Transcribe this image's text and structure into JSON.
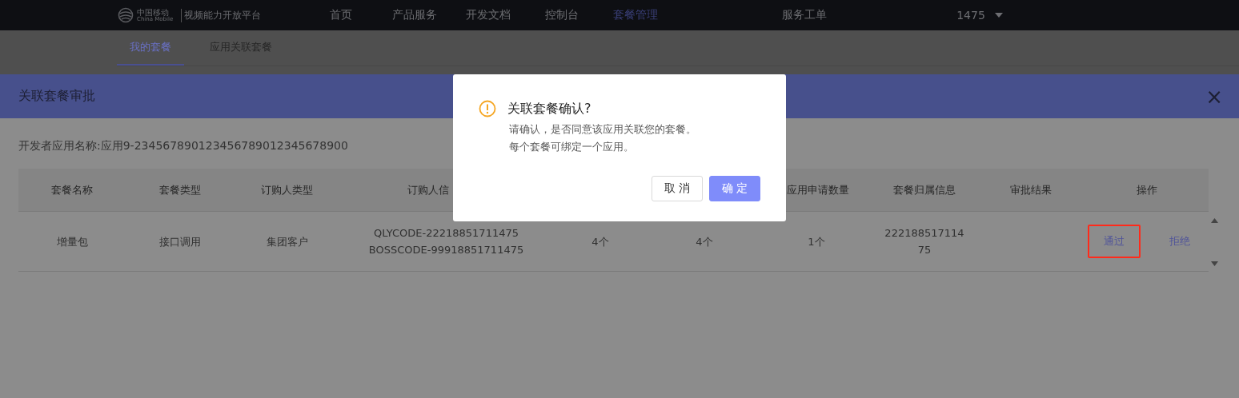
{
  "top_nav": {
    "logo": {
      "name_cn": "中国移动",
      "name_en": "China Mobile"
    },
    "platform": "视频能力开放平台",
    "items": [
      {
        "label": "首页",
        "selected": false
      },
      {
        "label": "产品服务",
        "selected": false
      },
      {
        "label": "开发文档",
        "selected": false
      },
      {
        "label": "控制台",
        "selected": false
      },
      {
        "label": "套餐管理",
        "selected": true
      }
    ],
    "service": "服务工单",
    "user": "1475"
  },
  "sub_tabs": [
    {
      "label": "我的套餐",
      "selected": true
    },
    {
      "label": "应用关联套餐",
      "selected": false
    }
  ],
  "drawer": {
    "title": "关联套餐审批",
    "close": "×",
    "app_name": "开发者应用名称:应用9-234567890123456789012345678900",
    "table": {
      "columns": [
        "套餐名称",
        "套餐类型",
        "订购人类型",
        "订购人信",
        null,
        null,
        "应用申请数量",
        "套餐归属信息",
        "审批结果",
        "操作"
      ],
      "rows": [
        {
          "cells": [
            "增量包",
            "接口调用",
            "集团客户",
            [
              "QLYCODE-22218851711475",
              "BOSSCODE-99918851711475"
            ],
            "4个",
            "4个",
            "1个",
            [
              "222188517114",
              "75"
            ],
            ""
          ],
          "actions": [
            {
              "label": "通过",
              "highlighted": true
            },
            {
              "label": "拒绝",
              "highlighted": false
            }
          ]
        }
      ]
    }
  },
  "dialog": {
    "title": "关联套餐确认?",
    "lines": [
      "请确认，是否同意该应用关联您的套餐。",
      "每个套餐可绑定一个应用。"
    ],
    "buttons": [
      {
        "label": "取 消",
        "kind": "default"
      },
      {
        "label": "确 定",
        "kind": "primary"
      }
    ]
  }
}
